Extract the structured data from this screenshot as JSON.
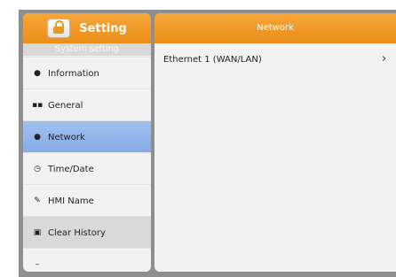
{
  "left_panel": {
    "title": "Setting",
    "subtitle": "System setting",
    "items": [
      {
        "label": "Information",
        "icon": "info-icon",
        "glyph": "●"
      },
      {
        "label": "General",
        "icon": "grid-icon",
        "glyph": "▪▪"
      },
      {
        "label": "Network",
        "icon": "network-icon",
        "glyph": "●",
        "active": true
      },
      {
        "label": "Time/Date",
        "icon": "clock-icon",
        "glyph": "◷"
      },
      {
        "label": "HMI Name",
        "icon": "pen-icon",
        "glyph": "✎"
      },
      {
        "label": "Clear History",
        "icon": "clear-history-icon",
        "glyph": "▣"
      }
    ]
  },
  "right_panel": {
    "title": "Network",
    "rows": [
      {
        "label": "Ethernet 1 (WAN/LAN)",
        "chevron": "›"
      }
    ]
  },
  "colors": {
    "header_orange": "#ea8e19",
    "active_blue": "#8fb3e9",
    "frame_gray": "#8e8e8e"
  }
}
